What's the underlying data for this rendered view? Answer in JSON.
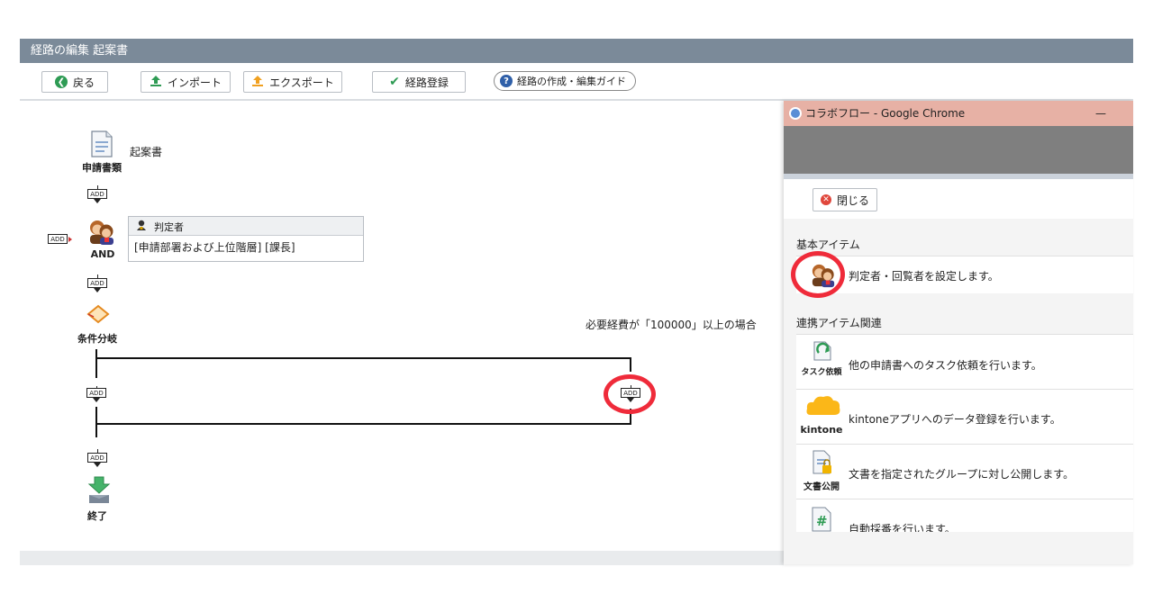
{
  "window": {
    "title": "経路の編集 起案書"
  },
  "toolbar": {
    "back_label": "戻る",
    "import_label": "インポート",
    "export_label": "エクスポート",
    "register_label": "経路登録",
    "guide_label": "経路の作成・編集ガイド"
  },
  "flow": {
    "application": {
      "label": "申請書類",
      "value": "起案書"
    },
    "add_label": "ADD",
    "approver": {
      "label": "AND",
      "header": "判定者",
      "value": "[申請部署および上位階層] [課長]"
    },
    "branch": {
      "label": "条件分岐",
      "condition": "必要経費が「100000」以上の場合"
    },
    "end": {
      "label": "終了"
    }
  },
  "popup": {
    "window_title": "コラボフロー - Google Chrome",
    "minimize_glyph": "—",
    "close_label": "閉じる",
    "section_basic": "基本アイテム",
    "basic_items": [
      {
        "icon": "approver-icon",
        "text": "判定者・回覧者を設定します。"
      }
    ],
    "section_integration": "連携アイテム関連",
    "integration_items": [
      {
        "icon": "task-request-icon",
        "caption": "タスク依頼",
        "text": "他の申請書へのタスク依頼を行います。"
      },
      {
        "icon": "kintone-icon",
        "caption": "kintone",
        "text": "kintoneアプリへのデータ登録を行います。"
      },
      {
        "icon": "document-publish-icon",
        "caption": "文書公開",
        "text": "文書を指定されたグループに対し公開します。"
      },
      {
        "icon": "auto-number-icon",
        "caption": "",
        "text": "自動採番を行います。"
      }
    ]
  },
  "colors": {
    "titlebar": "#7b8a99",
    "popup_titlebar": "#e7b1a5",
    "highlight_ring": "#ef2b3a",
    "back_icon": "#2e9b54",
    "import_icon": "#2e9b54",
    "export_icon": "#f0a020",
    "check_icon": "#2e9b54",
    "guide_icon": "#2f5fa8"
  }
}
